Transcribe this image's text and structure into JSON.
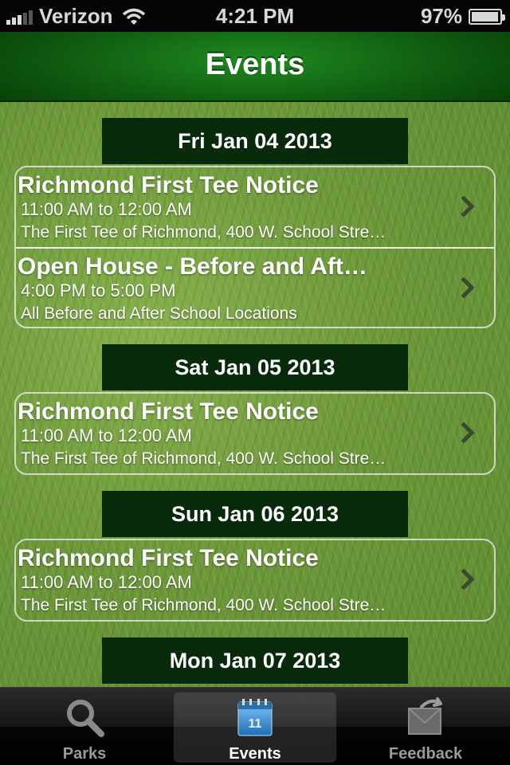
{
  "status_bar": {
    "carrier": "Verizon",
    "time": "4:21 PM",
    "battery": "97%",
    "battery_level": 0.97,
    "icons": [
      "signal-icon",
      "wifi-icon",
      "battery-icon"
    ]
  },
  "nav": {
    "title": "Events"
  },
  "days": [
    {
      "date": "Fri Jan 04 2013",
      "events": [
        {
          "title": "Richmond First Tee Notice",
          "time": "11:00 AM to 12:00 AM",
          "location": "The First Tee of Richmond, 400 W. School Stre…"
        },
        {
          "title": "Open House - Before and Aft…",
          "time": "4:00 PM to 5:00 PM",
          "location": "All Before and After School Locations"
        }
      ]
    },
    {
      "date": "Sat Jan 05 2013",
      "events": [
        {
          "title": "Richmond First Tee Notice",
          "time": "11:00 AM to 12:00 AM",
          "location": "The First Tee of Richmond, 400 W. School Stre…"
        }
      ]
    },
    {
      "date": "Sun Jan 06 2013",
      "events": [
        {
          "title": "Richmond First Tee Notice",
          "time": "11:00 AM to 12:00 AM",
          "location": "The First Tee of Richmond, 400 W. School Stre…"
        }
      ]
    },
    {
      "date": "Mon Jan 07 2013",
      "events": []
    }
  ],
  "tabs": [
    {
      "label": "Parks",
      "icon": "magnifier-icon",
      "active": false
    },
    {
      "label": "Events",
      "icon": "calendar-icon",
      "icon_text": "11",
      "active": true
    },
    {
      "label": "Feedback",
      "icon": "envelope-reply-icon",
      "active": false
    }
  ],
  "colors": {
    "nav_green": "#1f8a1f",
    "header_dark_green": "#062a0a",
    "grass": "#6f9b3c",
    "tab_active_icon": "#2f8fd8"
  }
}
